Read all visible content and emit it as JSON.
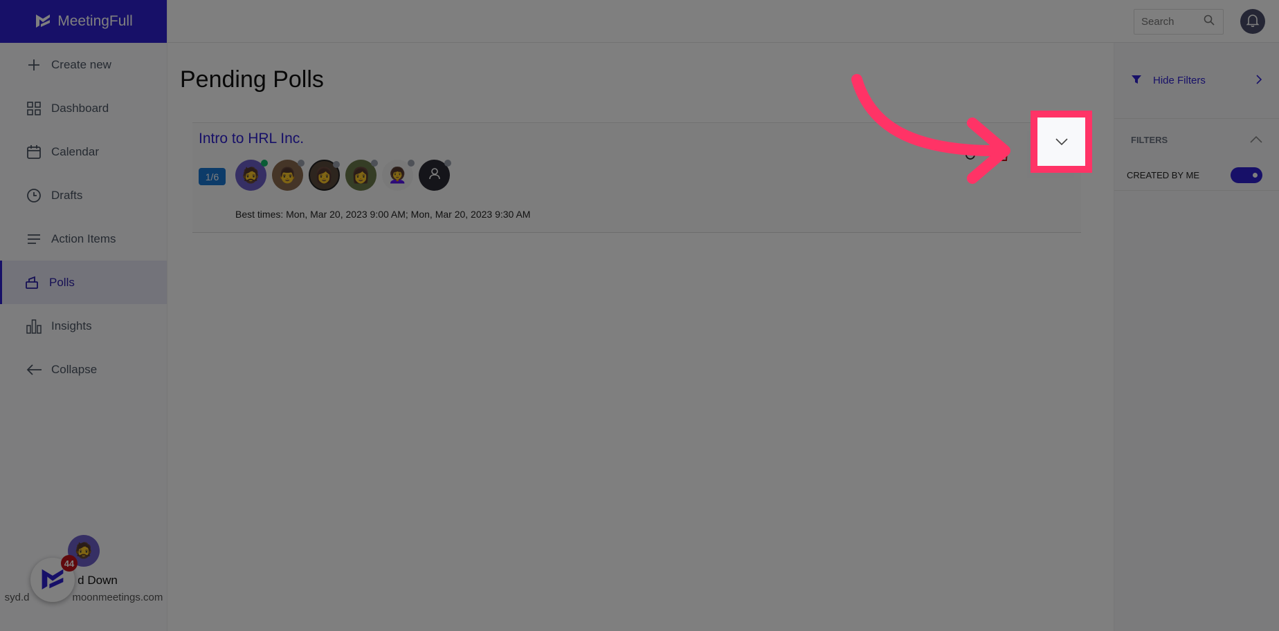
{
  "brand": {
    "name": "MeetingFull",
    "color": "#2e20d0"
  },
  "sidebar": {
    "items": [
      {
        "label": "Create new",
        "icon": "plus-icon"
      },
      {
        "label": "Dashboard",
        "icon": "grid-icon"
      },
      {
        "label": "Calendar",
        "icon": "calendar-icon"
      },
      {
        "label": "Drafts",
        "icon": "clock-icon"
      },
      {
        "label": "Action Items",
        "icon": "list-icon"
      },
      {
        "label": "Polls",
        "icon": "ballot-box-icon",
        "active": true
      },
      {
        "label": "Insights",
        "icon": "bar-chart-icon"
      },
      {
        "label": "Collapse",
        "icon": "arrow-left-icon"
      }
    ],
    "user": {
      "name_visible": "d Down",
      "email_visible_prefix": "syd.d",
      "email_visible_suffix": "moonmeetings.com"
    },
    "fab_badge": "44"
  },
  "topbar": {
    "search_placeholder": "Search"
  },
  "main": {
    "title": "Pending Polls",
    "polls": [
      {
        "title": "Intro to HRL Inc.",
        "response_badge": "1/6",
        "participants": [
          {
            "status": "online"
          },
          {
            "status": "offline"
          },
          {
            "status": "offline"
          },
          {
            "status": "offline"
          },
          {
            "status": "offline"
          },
          {
            "status": "offline",
            "placeholder": true
          }
        ],
        "best_times": "Best times: Mon, Mar 20, 2023 9:00 AM; Mon, Mar 20, 2023 9:30 AM"
      }
    ]
  },
  "filters": {
    "hide_label": "Hide Filters",
    "section_title": "FILTERS",
    "items": [
      {
        "label": "CREATED BY ME",
        "enabled": true
      }
    ]
  },
  "annotation": {
    "highlight_color": "#ff3366",
    "target": "expand-poll-button"
  }
}
